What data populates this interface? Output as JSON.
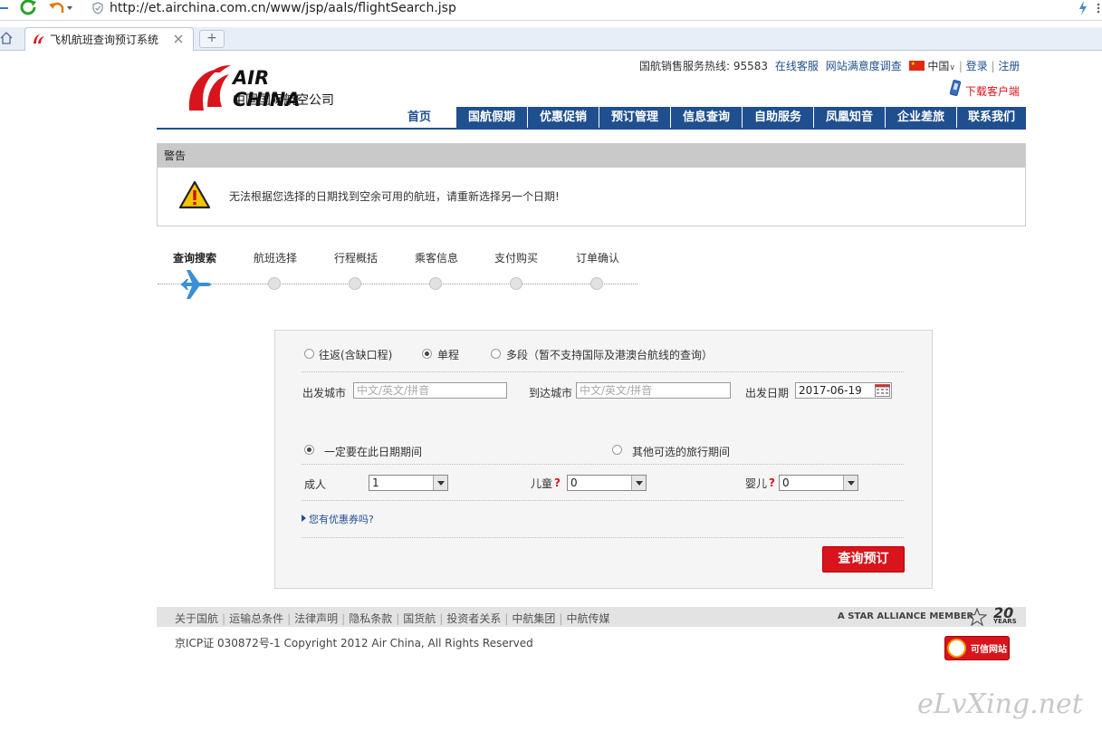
{
  "browser": {
    "url": "http://et.airchina.com.cn/www/jsp/aals/flightSearch.jsp",
    "tab_title": "飞机航班查询预订系统 ,",
    "new_tab": "+"
  },
  "header": {
    "logo_text_en": "AIR CHINA",
    "logo_text_cn": "中国国际航空公司",
    "hotline_label": "国航销售服务热线: 95583",
    "online_service": "在线客服",
    "survey": "网站满意度调查",
    "country": "中国",
    "login": "登录",
    "register": "注册",
    "download_client": "下载客户端",
    "nav_home": "首页",
    "nav": [
      "国航假期",
      "优惠促销",
      "预订管理",
      "信息查询",
      "自助服务",
      "凤凰知音",
      "企业差旅",
      "联系我们"
    ]
  },
  "warning": {
    "title": "警告",
    "message": "无法根据您选择的日期找到空余可用的航班，请重新选择另一个日期!"
  },
  "steps": [
    "查询搜索",
    "航班选择",
    "行程概括",
    "乘客信息",
    "支付购买",
    "订单确认"
  ],
  "form": {
    "trip_types": [
      "往返(含缺口程)",
      "单程",
      "多段（暂不支持国际及港澳台航线的查询）"
    ],
    "trip_selected": "单程",
    "depart_city_label": "出发城市",
    "depart_city_placeholder": "中文/英文/拼音",
    "arrive_city_label": "到达城市",
    "arrive_city_placeholder": "中文/英文/拼音",
    "depart_date_label": "出发日期",
    "depart_date_value": "2017-06-19",
    "date_option_fixed": "一定要在此日期期间",
    "date_option_flexible": "其他可选的旅行期间",
    "adult_label": "成人",
    "adult_value": "1",
    "child_label": "儿童",
    "child_value": "0",
    "infant_label": "婴儿",
    "infant_value": "0",
    "coupon_link": "您有优惠券吗?",
    "search_button": "查询预订"
  },
  "footer": {
    "links": [
      "关于国航",
      "运输总条件",
      "法律声明",
      "隐私条款",
      "国货航",
      "投资者关系",
      "中航集团",
      "中航传媒"
    ],
    "star_alliance": "A STAR ALLIANCE MEMBER",
    "anniv": "20",
    "anniv_sub": "YEARS",
    "copyright": "京ICP证 030872号-1 Copyright 2012 Air China, All Rights Reserved",
    "trust_badge": "可信网站"
  },
  "watermark": "eLvXing.net",
  "colors": {
    "brand_red": "#d8141c",
    "nav_blue": "#1f4f8f"
  }
}
